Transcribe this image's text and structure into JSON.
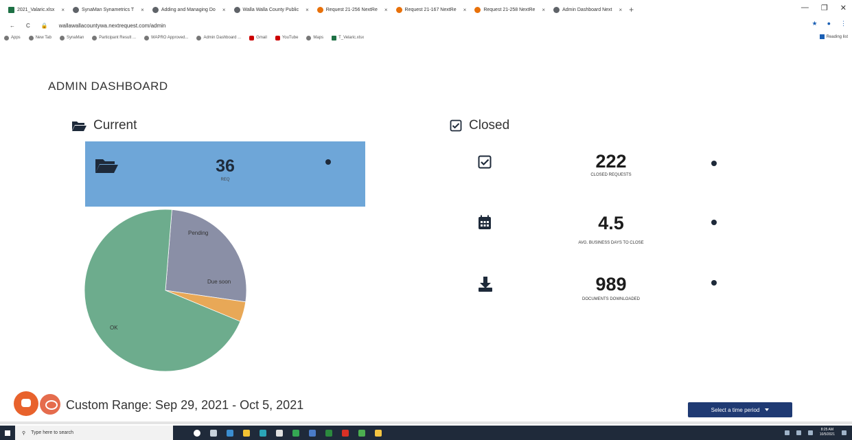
{
  "browser": {
    "tabs": [
      {
        "title": "2021_Valaric.xlsx",
        "icon": "excel-icon"
      },
      {
        "title": "SynaMan  Synametrics T",
        "icon": "globe-icon"
      },
      {
        "title": "Adding and Managing Do",
        "icon": "nextrequest-icon"
      },
      {
        "title": "Walla Walla County Public",
        "icon": "nextrequest-icon"
      },
      {
        "title": "Request 21-256  NextRe",
        "icon": "nextrequest-orange-icon"
      },
      {
        "title": "Request 21-167  NextRe",
        "icon": "nextrequest-orange-icon"
      },
      {
        "title": "Request 21-258  NextRe",
        "icon": "nextrequest-orange-icon"
      },
      {
        "title": "Admin Dashboard  Next",
        "icon": "nextrequest-icon"
      }
    ],
    "url": "wallawallacountywa.nextrequest.com/admin",
    "bookmarks": [
      {
        "label": "Apps",
        "icon": "apps-grid-icon"
      },
      {
        "label": "New Tab",
        "icon": "globe-icon"
      },
      {
        "label": "SynaMan",
        "icon": "globe-icon"
      },
      {
        "label": "Participant Result ...",
        "icon": "globe-icon"
      },
      {
        "label": "WAPRO Approved...",
        "icon": "globe-icon"
      },
      {
        "label": "Admin Dashboard ...",
        "icon": "globe-icon"
      },
      {
        "label": "Gmail",
        "icon": "gmail-icon"
      },
      {
        "label": "YouTube",
        "icon": "youtube-icon"
      },
      {
        "label": "Maps",
        "icon": "maps-icon"
      },
      {
        "label": "T_Velaric.xlsx",
        "icon": "excel-icon"
      }
    ],
    "reading_list": "Reading list"
  },
  "dashboard": {
    "title": "ADMIN DASHBOARD",
    "current": {
      "heading": "Current",
      "requests_value": "36",
      "requests_label": "REQ"
    },
    "closed": {
      "heading": "Closed",
      "stats": [
        {
          "value": "222",
          "label": "CLOSED REQUESTS",
          "icon": "checkbox-icon"
        },
        {
          "value": "4.5",
          "label": "AVG. BUSINESS DAYS TO CLOSE",
          "icon": "calendar-icon"
        },
        {
          "value": "989",
          "label": "DOCUMENTS DOWNLOADED",
          "icon": "download-icon"
        }
      ]
    },
    "range_text": "Custom Range: Sep 29, 2021 - Oct 5, 2021",
    "select_period_label": "Select a time period"
  },
  "chart_data": {
    "type": "pie",
    "slices": [
      {
        "label": "Pending",
        "value": 26,
        "color": "#8a8fa6"
      },
      {
        "label": "Due soon",
        "value": 4,
        "color": "#e8a857"
      },
      {
        "label": "OK",
        "value": 70,
        "color": "#6dac8d"
      }
    ]
  },
  "taskbar": {
    "search_placeholder": "Type here to search",
    "time": "8:25 AM",
    "date": "10/5/2021"
  }
}
